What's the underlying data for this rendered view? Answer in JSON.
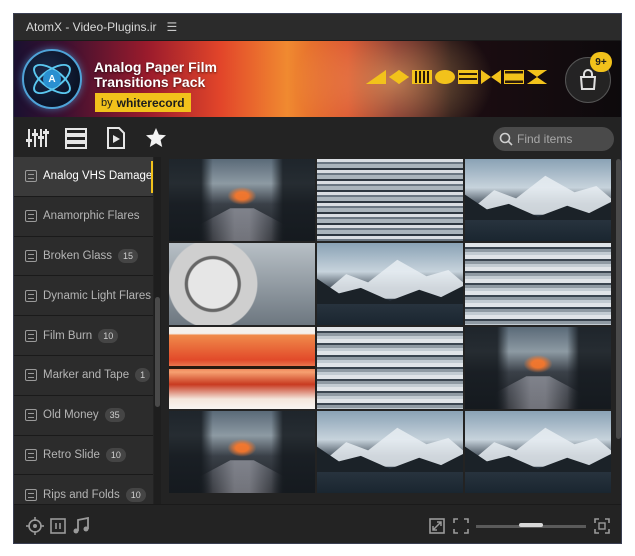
{
  "window": {
    "title": "AtomX - Video-Plugins.ir",
    "menu_icon": "hamburger-icon"
  },
  "banner": {
    "title_line1": "Analog Paper Film",
    "title_line2": "Transitions Pack",
    "by": "by",
    "author": "whiterecord",
    "logo_letter": "A",
    "cart_badge": "9+",
    "accent": "#f2c21b"
  },
  "toolbar": {
    "icons": [
      "sliders-icon",
      "list-icon",
      "play-file-icon",
      "star-icon"
    ]
  },
  "search": {
    "placeholder": "Find items",
    "value": ""
  },
  "sidebar": {
    "items": [
      {
        "label": "Analog VHS Damage",
        "count": "",
        "active": true
      },
      {
        "label": "Anamorphic Flares",
        "count": ""
      },
      {
        "label": "Broken Glass",
        "count": "15"
      },
      {
        "label": "Dynamic Light Flares",
        "count": ""
      },
      {
        "label": "Film Burn",
        "count": "10"
      },
      {
        "label": "Marker and Tape",
        "count": "1"
      },
      {
        "label": "Old Money",
        "count": "35"
      },
      {
        "label": "Retro Slide",
        "count": "10"
      },
      {
        "label": "Rips and Folds",
        "count": "10"
      }
    ]
  },
  "grid": {
    "thumbnails": [
      "train",
      "glitch",
      "mountain",
      "film",
      "mountain",
      "glitch2",
      "burn",
      "glitch2",
      "train",
      "train",
      "mountain",
      "mountain"
    ]
  },
  "statusbar": {
    "left_icons": [
      "target-icon",
      "pause-icon",
      "music-icon"
    ],
    "right_icons": [
      "expand-icon",
      "fit-icon",
      "fullscreen-icon"
    ],
    "zoom_level": 0.5
  }
}
